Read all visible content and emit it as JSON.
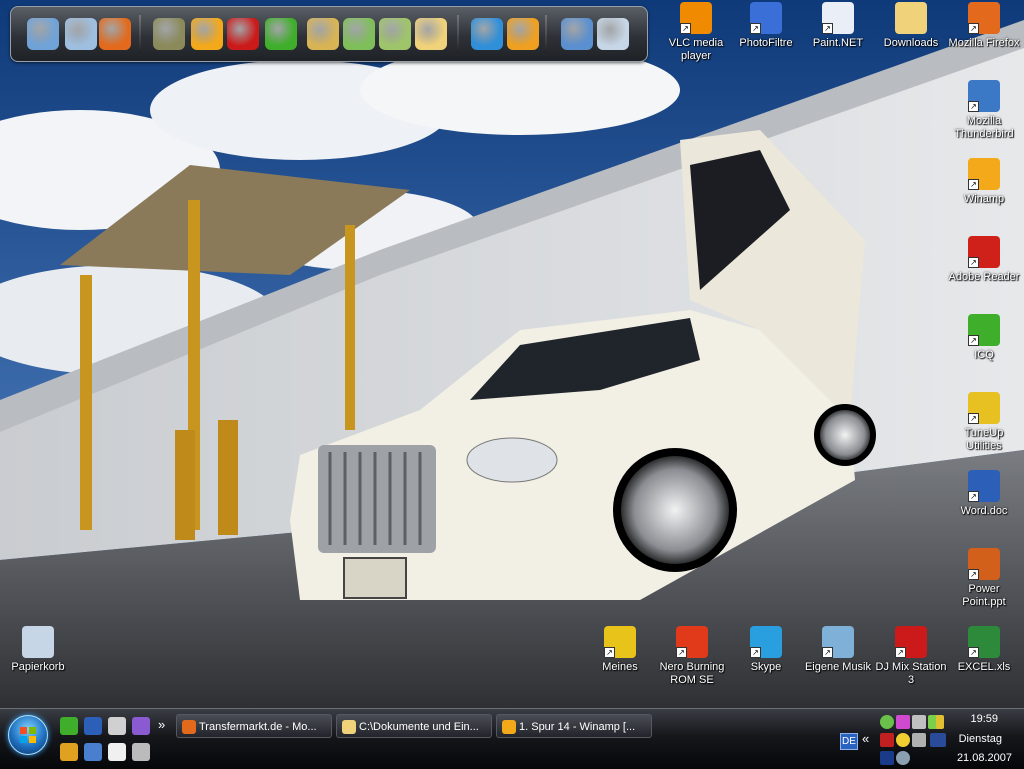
{
  "desktop_icons": [
    {
      "id": "vlc",
      "label": "VLC media player",
      "icon": "vlc-cone-icon",
      "color": "#f08a00"
    },
    {
      "id": "photofiltre",
      "label": "PhotoFiltre",
      "icon": "photofiltre-icon",
      "color": "#3a6fd8"
    },
    {
      "id": "paintnet",
      "label": "Paint.NET",
      "icon": "paintnet-icon",
      "color": "#e9eef7"
    },
    {
      "id": "downloads",
      "label": "Downloads",
      "icon": "folder-icon",
      "color": "#f0d27a"
    },
    {
      "id": "firefox",
      "label": "Mozilla Firefox",
      "icon": "firefox-icon",
      "color": "#e36a1c"
    },
    {
      "id": "thunderbird",
      "label": "Mozilla Thunderbird",
      "icon": "thunderbird-icon",
      "color": "#3b78c6"
    },
    {
      "id": "winamp",
      "label": "Winamp",
      "icon": "winamp-icon",
      "color": "#f3a91a"
    },
    {
      "id": "adobe",
      "label": "Adobe Reader",
      "icon": "adobe-reader-icon",
      "color": "#d0201a"
    },
    {
      "id": "icq",
      "label": "ICQ",
      "icon": "icq-flower-icon",
      "color": "#3fae2a"
    },
    {
      "id": "tuneup",
      "label": "TuneUp Utilities",
      "icon": "tuneup-icon",
      "color": "#e7c021"
    },
    {
      "id": "word",
      "label": "Word.doc",
      "icon": "word-doc-icon",
      "color": "#2b5fb8"
    },
    {
      "id": "powerpoint",
      "label": "Power Point.ppt",
      "icon": "powerpoint-icon",
      "color": "#d2601a"
    },
    {
      "id": "excel",
      "label": "EXCEL.xls",
      "icon": "excel-icon",
      "color": "#2c8a3a"
    },
    {
      "id": "djmix",
      "label": "DJ Mix Station 3",
      "icon": "djmix-icon",
      "color": "#cc1a1a"
    },
    {
      "id": "music",
      "label": "Eigene Musik",
      "icon": "music-folder-icon",
      "color": "#7fb0d8"
    },
    {
      "id": "skype",
      "label": "Skype",
      "icon": "skype-icon",
      "color": "#2a9fe0"
    },
    {
      "id": "nero",
      "label": "Nero Burning ROM SE",
      "icon": "nero-icon",
      "color": "#e03a1a"
    },
    {
      "id": "meines",
      "label": "Meines",
      "icon": "star-folder-icon",
      "color": "#e8c31a"
    },
    {
      "id": "recycle",
      "label": "Papierkorb",
      "icon": "recycle-bin-icon",
      "color": "#c6d6e6"
    }
  ],
  "dock": [
    {
      "icon": "computer-icon",
      "color": "#6fa3d8"
    },
    {
      "icon": "network-icon",
      "color": "#9fbfe0"
    },
    {
      "icon": "firefox-icon",
      "color": "#e36a1c"
    },
    {
      "icon": "battlefield-icon",
      "color": "#8a8a5a"
    },
    {
      "icon": "winamp-icon",
      "color": "#f3a91a"
    },
    {
      "icon": "djmix-icon",
      "color": "#cc1a1a"
    },
    {
      "icon": "icq-flower-icon",
      "color": "#3fae2a"
    },
    {
      "icon": "library-icon",
      "color": "#d9b455"
    },
    {
      "icon": "pictures-folder-icon",
      "color": "#7fbf5a"
    },
    {
      "icon": "documents-folder-icon",
      "color": "#9fc56a"
    },
    {
      "icon": "folder-icon",
      "color": "#f0d27a"
    },
    {
      "icon": "globe-icon",
      "color": "#2f8fd8"
    },
    {
      "icon": "media-player-icon",
      "color": "#f0a020"
    },
    {
      "icon": "gears-icon",
      "color": "#5a8fd0"
    },
    {
      "icon": "recycle-bin-icon",
      "color": "#c6d6e6"
    }
  ],
  "taskbar": {
    "quick_launch": [
      {
        "icon": "icq-flower-icon",
        "color": "#3fae2a"
      },
      {
        "icon": "word-icon",
        "color": "#2b5fb8"
      },
      {
        "icon": "terminal-icon",
        "color": "#d0d0d0"
      },
      {
        "icon": "shield-icon",
        "color": "#8a5ad0"
      },
      {
        "icon": "colorful-app-icon",
        "color": "#e0a020"
      },
      {
        "icon": "desktop-icon",
        "color": "#4a7fd0"
      },
      {
        "icon": "media-player-icon",
        "color": "#f0f0f0"
      },
      {
        "icon": "stack-icon",
        "color": "#bbbbbb"
      }
    ],
    "overflow_label": "»",
    "windows": [
      {
        "label": "Transfermarkt.de - Mo...",
        "icon": "firefox-icon",
        "color": "#e36a1c"
      },
      {
        "label": "C:\\Dokumente und Ein...",
        "icon": "folder-icon",
        "color": "#f0d27a"
      },
      {
        "label": "1. Spur 14 - Winamp [...",
        "icon": "winamp-icon",
        "color": "#f3a91a"
      }
    ],
    "tray": {
      "lang": "DE",
      "chevron": "«",
      "time": "19:59",
      "day": "Dienstag",
      "date": "21.08.2007"
    }
  }
}
